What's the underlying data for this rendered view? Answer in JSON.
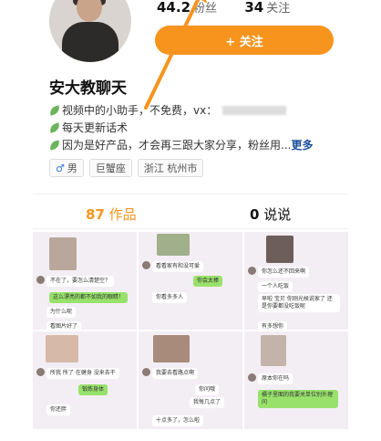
{
  "profile": {
    "nickname": "安大教聊天",
    "followers_count": "44.2",
    "followers_label": "粉丝",
    "following_count": "34",
    "following_label": "关注",
    "follow_button": "+ 关注"
  },
  "bio": {
    "line1": "视频中的小助手，不免费，vx：",
    "line2": "每天更新话术",
    "line3": "因为是好产品，才会再三跟大家分享，粉丝用...",
    "more": "更多"
  },
  "tags": [
    {
      "icon": "male-icon",
      "glyph": "♂",
      "label": "男"
    },
    {
      "label": "巨蟹座"
    },
    {
      "label": "浙江 杭州市"
    }
  ],
  "tabs": {
    "works_count": "87",
    "works_label": "作品",
    "posts_count": "0",
    "posts_label": "说说"
  },
  "colors": {
    "accent": "#f7941d",
    "link": "#1a4f9c"
  },
  "thumbnails": [
    {
      "bubbles": [
        "不在了，要怎么清楚空？",
        "这么漂亮的都不如我的眼睛！",
        "为什么呢",
        "看图片好了"
      ]
    },
    {
      "bubbles": [
        "看看家有和没可爱",
        "你会太棒",
        "你看多多人"
      ]
    },
    {
      "bubbles": [
        "你怎么还不回来啊",
        "一个人吃饭",
        "早啦 宝贝 你刚光候说家了 还是你要都没吃饭呢",
        "有多想你"
      ]
    },
    {
      "bubbles": [
        "所我 所了 在健身 没来去干",
        "锻炼身体",
        "你还胖"
      ]
    },
    {
      "bubbles": [
        "我要去看路点啊",
        "你问哦",
        "我每几点了",
        "十点多了，怎么啦"
      ]
    },
    {
      "bubbles": [
        "原本你在吗",
        "橘子里面的我要关单位别外理问"
      ]
    }
  ]
}
